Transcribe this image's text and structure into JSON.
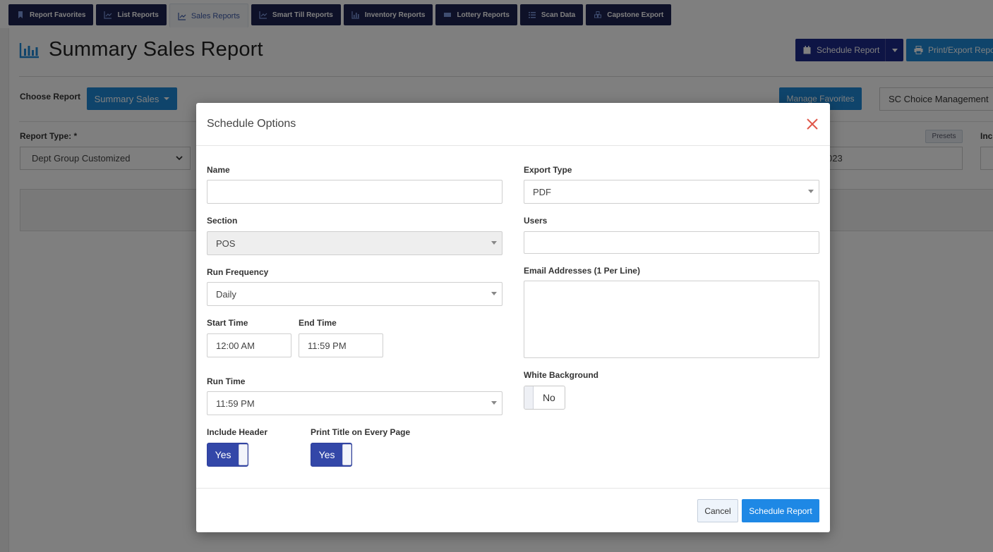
{
  "tabs": [
    {
      "label": "Report Favorites",
      "icon": "bookmark-icon"
    },
    {
      "label": "List Reports",
      "icon": "line-chart-icon"
    },
    {
      "label": "Sales Reports",
      "icon": "line-chart-icon"
    },
    {
      "label": "Smart Till Reports",
      "icon": "line-chart-icon"
    },
    {
      "label": "Inventory Reports",
      "icon": "bar-chart-icon"
    },
    {
      "label": "Lottery Reports",
      "icon": "ticket-icon"
    },
    {
      "label": "Scan Data",
      "icon": "list-icon"
    },
    {
      "label": "Capstone Export",
      "icon": "cubes-icon"
    }
  ],
  "active_tab": "Sales Reports",
  "page": {
    "title": "Summary Sales Report",
    "schedule_button": "Schedule Report",
    "print_button": "Print/Export Report",
    "choose_report_label": "Choose Report",
    "report_dropdown": "Summary Sales",
    "manage_favorites": "Manage Favorites",
    "store_select": "SC Choice Management",
    "report_type_label": "Report Type: *",
    "report_type_value": "Dept Group Customized",
    "presets_button": "Presets",
    "include_label": "Inc",
    "date_partial": "023"
  },
  "modal": {
    "title": "Schedule Options",
    "name_label": "Name",
    "name_value": "",
    "section_label": "Section",
    "section_value": "POS",
    "run_frequency_label": "Run Frequency",
    "run_frequency_value": "Daily",
    "start_time_label": "Start Time",
    "start_time_value": "12:00 AM",
    "end_time_label": "End Time",
    "end_time_value": "11:59 PM",
    "run_time_label": "Run Time",
    "run_time_value": "11:59 PM",
    "include_header_label": "Include Header",
    "include_header_value": "Yes",
    "print_title_label": "Print Title on Every Page",
    "print_title_value": "Yes",
    "export_type_label": "Export Type",
    "export_type_value": "PDF",
    "users_label": "Users",
    "users_value": "",
    "emails_label": "Email Addresses (1 Per Line)",
    "emails_value": "",
    "white_bg_label": "White Background",
    "white_bg_value": "No",
    "cancel_button": "Cancel",
    "submit_button": "Schedule Report"
  },
  "colors": {
    "nav_dark": "#1d2251",
    "primary_blue": "#1e88d6",
    "schedule_navy": "#1d2a8a",
    "toggle_on": "#3347a8",
    "close_red": "#e0574a"
  }
}
